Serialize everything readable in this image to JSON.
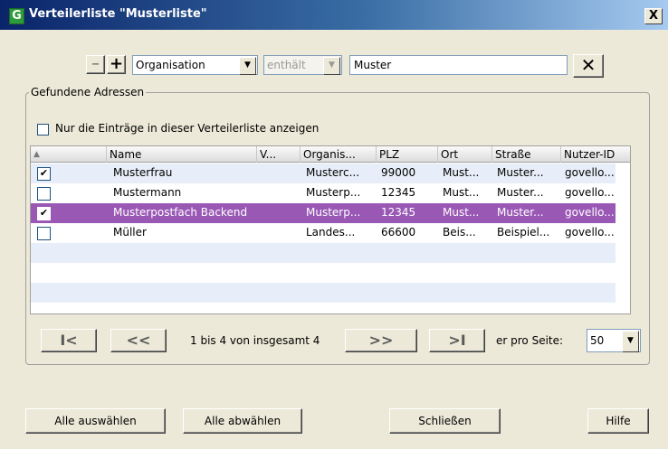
{
  "window": {
    "title": "Verteilerliste \"Musterliste\"",
    "app_icon_letter": "G",
    "close_label": "X"
  },
  "filter": {
    "minus_label": "–",
    "plus_label": "+",
    "field": "Organisation",
    "operator": "enthält",
    "search_value": "Muster",
    "clear_label": "✕"
  },
  "group": {
    "label": "Gefundene Adressen",
    "only_list_label": "Nur die Einträge in dieser Verteilerliste anzeigen",
    "only_list_checked": false
  },
  "table": {
    "columns": [
      "",
      "Name",
      "V...",
      "Organis...",
      "PLZ",
      "Ort",
      "Straße",
      "Nutzer-ID"
    ],
    "sort_glyph": "▲",
    "rows": [
      {
        "checked": "✔",
        "name": "Musterfrau",
        "v": "",
        "org": "Musterc...",
        "plz": "99000",
        "ort": "Must...",
        "strasse": "Muster...",
        "nutzer": "govello..."
      },
      {
        "checked": "",
        "name": "Mustermann",
        "v": "",
        "org": "Musterp...",
        "plz": "12345",
        "ort": "Must...",
        "strasse": "Muster...",
        "nutzer": "govello..."
      },
      {
        "checked": "✔",
        "name": "Musterpostfach Backend",
        "v": "",
        "org": "Musterp...",
        "plz": "12345",
        "ort": "Must...",
        "strasse": "Muster...",
        "nutzer": "govello..."
      },
      {
        "checked": "",
        "name": "Müller",
        "v": "",
        "org": "Landes...",
        "plz": "66600",
        "ort": "Beis...",
        "strasse": "Beispiel...",
        "nutzer": "govello..."
      }
    ],
    "selected_row": 2
  },
  "pager": {
    "first_label": "I<",
    "prev_label": "<<",
    "info": "1 bis 4 von insgesamt 4",
    "next_label": ">>",
    "last_label": ">I",
    "per_page_label": "er pro Seite:",
    "per_page_value": "50"
  },
  "buttons": {
    "select_all": "Alle auswählen",
    "deselect_all": "Alle abwählen",
    "close": "Schließen",
    "help": "Hilfe"
  },
  "colors": {
    "selection": "#9a58b5",
    "titlebar_start": "#0a246a",
    "titlebar_end": "#a6caf0"
  }
}
